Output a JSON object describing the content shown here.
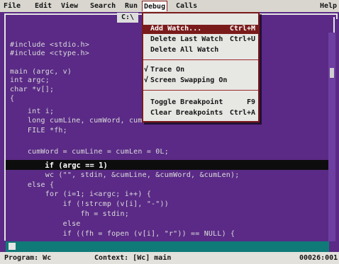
{
  "menu": {
    "items": [
      "File",
      "Edit",
      "View",
      "Search",
      "Run",
      "Debug",
      "Calls"
    ],
    "help": "Help",
    "active": "Debug"
  },
  "window": {
    "title": "C:\\"
  },
  "debug_menu": {
    "items": [
      {
        "label": "Add Watch...",
        "shortcut": "Ctrl+M",
        "checked": "",
        "selected": true
      },
      {
        "label": "Delete Last Watch",
        "shortcut": "Ctrl+U",
        "checked": "",
        "selected": false
      },
      {
        "label": "Delete All Watch",
        "shortcut": "",
        "checked": "",
        "selected": false
      },
      {
        "label": "Trace On",
        "shortcut": "",
        "checked": "√",
        "selected": false
      },
      {
        "label": "Screen Swapping On",
        "shortcut": "",
        "checked": "√",
        "selected": false
      },
      {
        "label": "Toggle Breakpoint",
        "shortcut": "F9",
        "checked": "",
        "selected": false
      },
      {
        "label": "Clear Breakpoints",
        "shortcut": "Ctrl+A",
        "checked": "",
        "selected": false
      }
    ]
  },
  "code": {
    "lines": [
      "#include <stdio.h>",
      "#include <ctype.h>",
      "",
      "main (argc, v)",
      "int argc;",
      "char *v[];",
      "{",
      "    int i;",
      "    long cumLine, cumWord, cum",
      "    FILE *fh;",
      "",
      "    cumWord = cumLine = cumLen = 0L;",
      "    if (argc == 1)",
      "        wc (\"\", stdin, &cumLine, &cumWord, &cumLen);",
      "    else {",
      "        for (i=1; i<argc; i++) {",
      "            if (!strcmp (v[i], \"-\"))",
      "                fh = stdin;",
      "            else",
      "            if ((fh = fopen (v[i], \"r\")) == NULL) {"
    ]
  },
  "status": {
    "program": "Program: Wc",
    "context": "Context: [Wc] main",
    "position": "00026:001"
  }
}
